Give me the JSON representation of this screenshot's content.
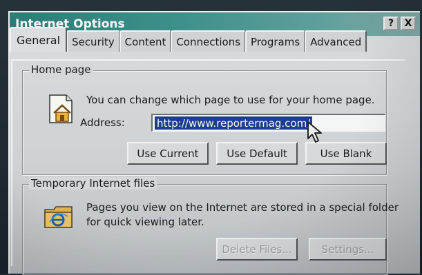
{
  "window": {
    "title": "Internet Options",
    "buttons": {
      "help": "?",
      "close": "X"
    }
  },
  "tabs": [
    {
      "label": "General",
      "active": true
    },
    {
      "label": "Security",
      "active": false
    },
    {
      "label": "Content",
      "active": false
    },
    {
      "label": "Connections",
      "active": false
    },
    {
      "label": "Programs",
      "active": false
    },
    {
      "label": "Advanced",
      "active": false
    }
  ],
  "home_page": {
    "group_title": "Home page",
    "description": "You can change which page to use for your home page.",
    "address_label": "Address:",
    "address_value": "http://www.reportermag.com/",
    "buttons": {
      "use_current": "Use Current",
      "use_default": "Use Default",
      "use_blank": "Use Blank"
    },
    "icon": "house-page-icon"
  },
  "temp_files": {
    "group_title": "Temporary Internet files",
    "description_line1": "Pages you view on the Internet are stored in a special folder",
    "description_line2": "for quick viewing later.",
    "buttons": {
      "delete_files": "Delete Files...",
      "settings": "Settings..."
    },
    "icon": "ie-folder-icon"
  },
  "colors": {
    "titlebar_start": "#2b7d76",
    "selection": "#1c3e8e"
  }
}
